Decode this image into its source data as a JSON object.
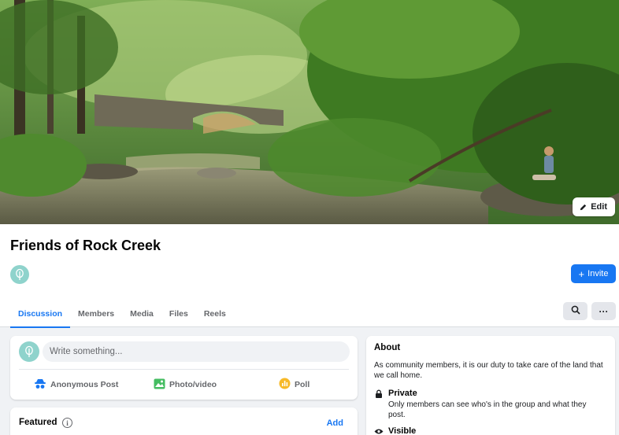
{
  "cover": {
    "edit_label": "Edit"
  },
  "group": {
    "title": "Friends of Rock Creek",
    "invite_label": "Invite"
  },
  "tabs": [
    {
      "label": "Discussion",
      "active": true
    },
    {
      "label": "Members",
      "active": false
    },
    {
      "label": "Media",
      "active": false
    },
    {
      "label": "Files",
      "active": false
    },
    {
      "label": "Reels",
      "active": false
    }
  ],
  "header_actions": {
    "search_icon": "search-icon",
    "more_label": "···"
  },
  "composer": {
    "placeholder": "Write something...",
    "actions": [
      {
        "label": "Anonymous Post",
        "icon": "anonymous-icon"
      },
      {
        "label": "Photo/video",
        "icon": "photo-icon"
      },
      {
        "label": "Poll",
        "icon": "poll-icon"
      }
    ]
  },
  "featured": {
    "title": "Featured",
    "add_label": "Add"
  },
  "about": {
    "title": "About",
    "description": "As community members, it is our duty to take care of the land that we call home.",
    "privacy": {
      "title": "Private",
      "description": "Only members can see who's in the group and what they post."
    },
    "visibility": {
      "title": "Visible"
    }
  },
  "colors": {
    "accent": "#1877f2",
    "page_bg": "#f0f2f5",
    "group_icon": "#8fd3cc"
  }
}
